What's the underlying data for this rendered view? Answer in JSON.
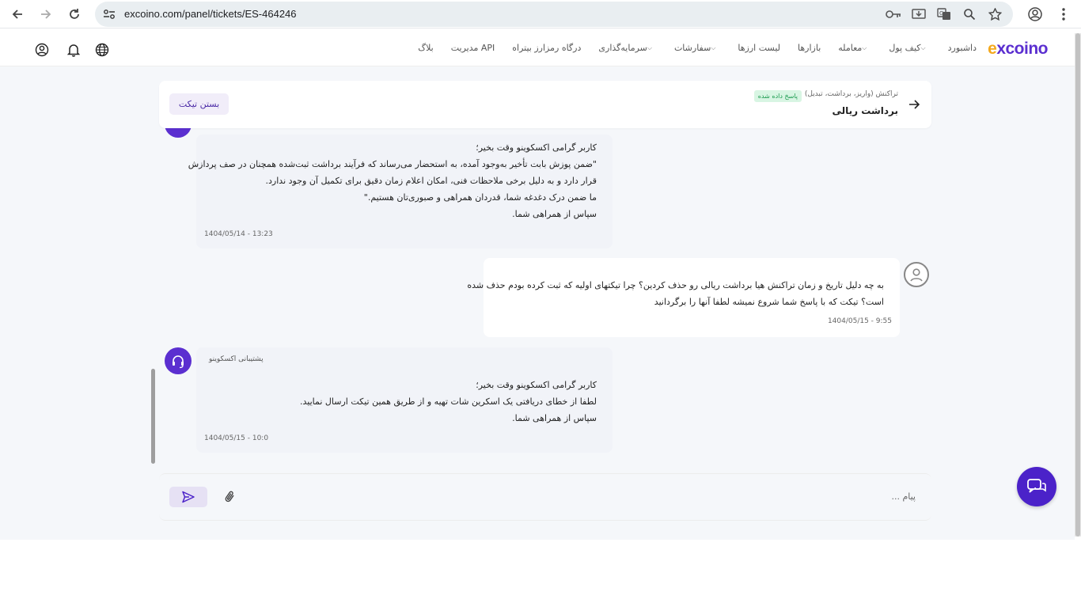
{
  "browser": {
    "url": "excoino.com/panel/tickets/ES-464246",
    "icons": [
      "back-arrow-icon",
      "forward-arrow-icon",
      "reload-icon",
      "site-settings-icon",
      "password-key-icon",
      "install-app-icon",
      "translate-icon",
      "zoom-icon",
      "bookmark-star-icon",
      "profile-icon",
      "menu-kebab-icon"
    ]
  },
  "header": {
    "logo_e": "e",
    "logo_rest": "xcoino",
    "nav": [
      {
        "label": "داشبورد",
        "dropdown": false
      },
      {
        "label": "کیف پول",
        "dropdown": true
      },
      {
        "label": "معامله",
        "dropdown": true
      },
      {
        "label": "بازارها",
        "dropdown": false
      },
      {
        "label": "لیست ارزها",
        "dropdown": false
      },
      {
        "label": "سفارشات",
        "dropdown": true
      },
      {
        "label": "سرمایه‌گذاری",
        "dropdown": true
      },
      {
        "label": "درگاه رمزارز بیتراه",
        "dropdown": false
      },
      {
        "label": "مدیریت API",
        "dropdown": false
      },
      {
        "label": "بلاگ",
        "dropdown": false
      }
    ]
  },
  "ticket": {
    "category": "تراکنش (واریز، برداشت، تبدیل)",
    "status": "پاسخ داده شده",
    "title": "برداشت ریالی",
    "close_label": "بستن تیکت"
  },
  "messages": {
    "m1": {
      "lines": [
        "کاربر گرامی اکسکوینو وقت بخیر؛",
        "\"ضمن پوزش بابت تأخیر به‌وجود آمده، به استحضار می‌رساند که فرآیند برداشت ثبت‌شده همچنان در صف پردازش",
        "قرار دارد و به دلیل برخی ملاحظات فنی، امکان اعلام زمان دقیق برای تکمیل آن وجود ندارد.",
        "ما ضمن درک دغدغه شما، قدردان همراهی و صبوری‌تان هستیم.\"",
        "سپاس از همراهی شما."
      ],
      "time": "1404/05/14 - 13:23"
    },
    "m2": {
      "lines": [
        "به چه دلیل تاریخ و زمان تراکنش هیا برداشت ریالی رو حذف کردین؟ چرا تیکتهای اولیه که ثبت کرده بودم حذف شده",
        "است؟ تیکت که با پاسخ شما شروع نمیشه لطفا آنها را برگردانید"
      ],
      "time": "1404/05/15 - 9:55"
    },
    "m3": {
      "sender": "پشتیبانی اکسکوینو",
      "lines": [
        "کاربر گرامی اکسکوینو وقت بخیر؛",
        "لطفا از خطای دریافتی یک اسکرین شات تهیه و از طریق همین تیکت ارسال نمایید.",
        "سپاس از همراهی شما."
      ],
      "time": "1404/05/15 - 10:0"
    }
  },
  "composer": {
    "placeholder": "پیام ..."
  },
  "colors": {
    "brand": "#5b2fd0",
    "accent": "#f4a91d",
    "status_green": "#1a9a4e"
  }
}
